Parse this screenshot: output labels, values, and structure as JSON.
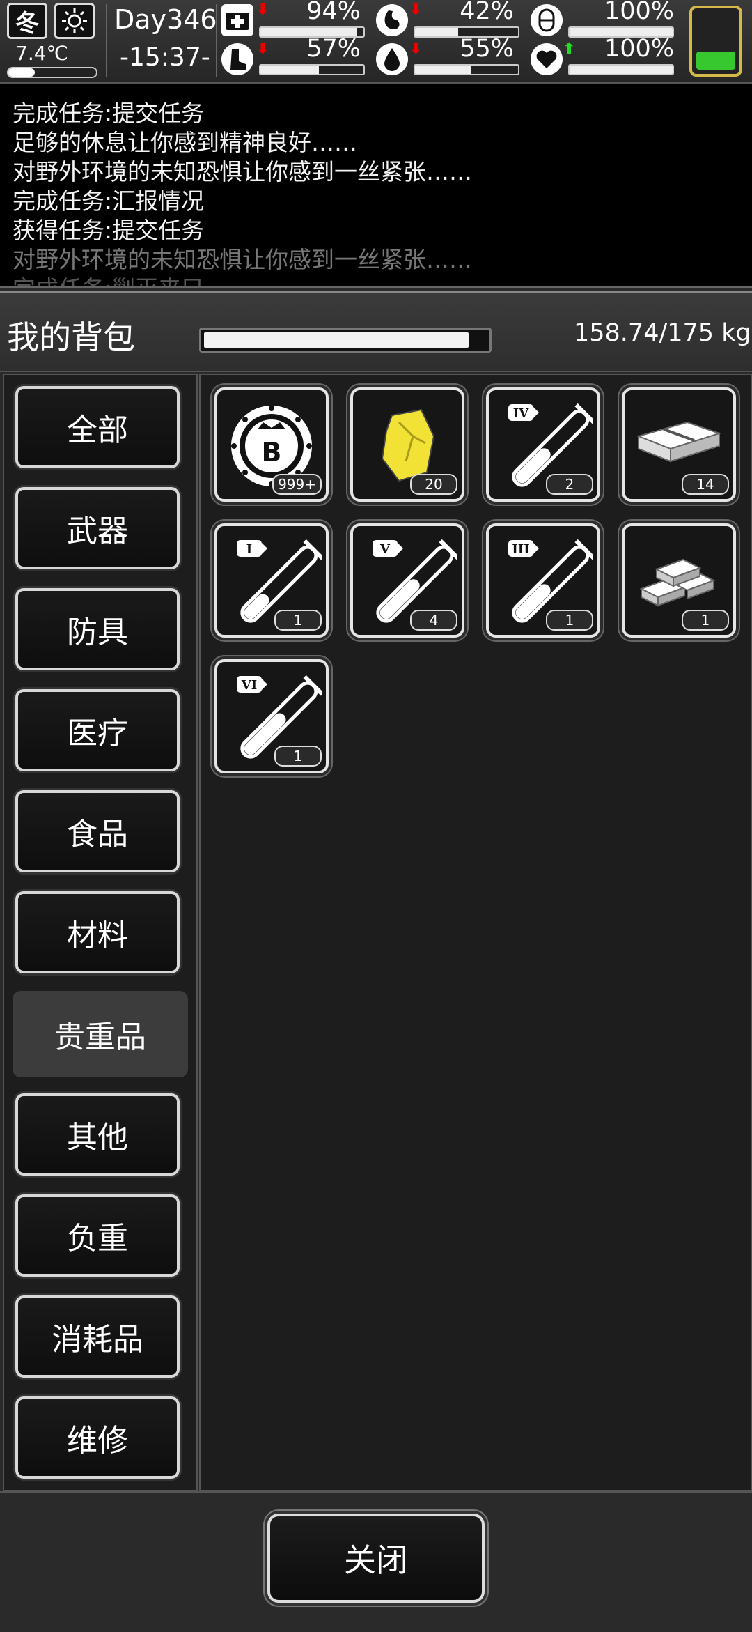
{
  "status": {
    "season": "冬",
    "weather_icon": "sun-icon",
    "temperature": "7.4℃",
    "day": "Day346",
    "time": "-15:37-",
    "stats": [
      {
        "name": "health",
        "icon": "medkit-icon",
        "value": "94%",
        "fraction": 0.94,
        "trend": "down"
      },
      {
        "name": "hunger",
        "icon": "stomach-icon",
        "value": "42%",
        "fraction": 0.42,
        "trend": "down"
      },
      {
        "name": "pill",
        "icon": "pill-icon",
        "value": "100%",
        "fraction": 1.0,
        "trend": "none"
      },
      {
        "name": "stamina",
        "icon": "boot-icon",
        "value": "57%",
        "fraction": 0.57,
        "trend": "down"
      },
      {
        "name": "thirst",
        "icon": "water-drop-icon",
        "value": "55%",
        "fraction": 0.55,
        "trend": "down"
      },
      {
        "name": "mood",
        "icon": "heart-icon",
        "value": "100%",
        "fraction": 1.0,
        "trend": "up"
      }
    ],
    "battery_fraction": 0.4
  },
  "log": [
    "完成任务:提交任务",
    "足够的休息让你感到精神良好……",
    "对野外环境的未知恐惧让你感到一丝紧张……",
    "完成任务:汇报情况",
    "获得任务:提交任务",
    "对野外环境的未知恐惧让你感到一丝紧张……",
    "完成任务:剿灭来巳"
  ],
  "bag": {
    "title": "我的背包",
    "weight": "158.74/175 kg",
    "weight_fraction": 0.907
  },
  "categories": [
    "全部",
    "武器",
    "防具",
    "医疗",
    "食品",
    "材料",
    "贵重品",
    "其他",
    "负重",
    "消耗品",
    "维修"
  ],
  "active_category": "贵重品",
  "items": [
    {
      "icon": "bitcoin-coin-icon",
      "count": "999+"
    },
    {
      "icon": "gold-nugget-icon",
      "count": "20"
    },
    {
      "icon": "test-tube-iv-icon",
      "count": "2"
    },
    {
      "icon": "cash-bundle-icon",
      "count": "14"
    },
    {
      "icon": "test-tube-i-icon",
      "count": "1"
    },
    {
      "icon": "test-tube-v-icon",
      "count": "4"
    },
    {
      "icon": "test-tube-iii-icon",
      "count": "1"
    },
    {
      "icon": "silver-bars-icon",
      "count": "1"
    },
    {
      "icon": "test-tube-vi-icon",
      "count": "1"
    }
  ],
  "tube_labels": {
    "iv": "IV",
    "i": "I",
    "v": "V",
    "iii": "III",
    "vi": "VI"
  },
  "footer": {
    "close_label": "关闭"
  }
}
